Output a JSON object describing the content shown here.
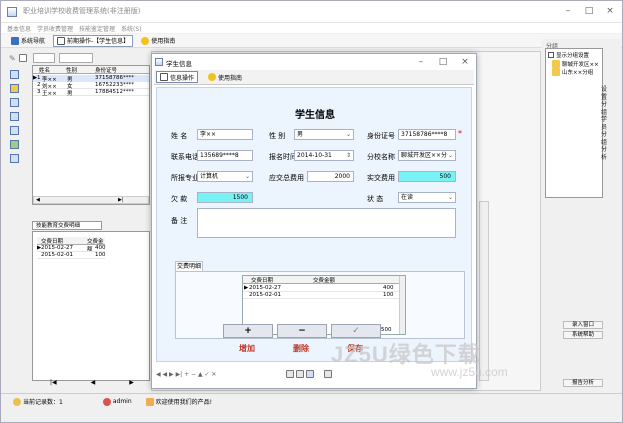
{
  "app": {
    "title": "职业培训学校收费管理系统(非注册版)",
    "window_controls": [
      "–",
      "□",
      "×"
    ]
  },
  "menu": [
    "基本信息",
    "学员收费管理",
    "技能鉴定管理",
    "系统(S)"
  ],
  "toolbar": {
    "tabs": [
      {
        "label": "系统导航",
        "active": false
      },
      {
        "label": "前期操作-【学生信息】",
        "active": true
      },
      {
        "label": "使用指南",
        "active": false
      }
    ]
  },
  "left_grid": {
    "headers": [
      "",
      "姓名",
      "性别",
      "身份证号"
    ],
    "rows": [
      {
        "marker": "▶",
        "num": "1",
        "name": "李××",
        "gender": "男",
        "id": "37158786****"
      },
      {
        "marker": "",
        "num": "2",
        "name": "刘××",
        "gender": "女",
        "id": "16752233****"
      },
      {
        "marker": "",
        "num": "3",
        "name": "王××",
        "gender": "男",
        "id": "17884512****"
      }
    ]
  },
  "left_pay": {
    "tab_label": "技能教育交费明细",
    "headers": [
      "交费日期",
      "交费金额"
    ],
    "rows": [
      {
        "marker": "▶",
        "date": "2015-02-27",
        "amount": "400"
      },
      {
        "marker": "",
        "date": "2015-02-01",
        "amount": "100"
      }
    ]
  },
  "statusbar": {
    "record_count": "当前记录数：1",
    "user": "admin",
    "welcome": "欢迎使用我们的产品!"
  },
  "right_panel": {
    "title": "分组",
    "show_tree_label": "显示分组设置",
    "tree": [
      "聊城开发区××",
      "山东××分组"
    ],
    "side_text": [
      "设",
      "置",
      "分",
      "组",
      "学",
      "员",
      "分",
      "组",
      "分",
      "析"
    ],
    "buttons": [
      "录入窗口",
      "系统帮助",
      "报告分析"
    ]
  },
  "dialog": {
    "title": "学生信息",
    "window_controls": [
      "–",
      "□",
      "×"
    ],
    "tabs": [
      {
        "label": "信息操作",
        "active": true
      },
      {
        "label": "使用指南",
        "active": false
      }
    ],
    "form_title": "学生信息",
    "labels": {
      "name": "姓    名",
      "gender": "性    别",
      "id_card": "身份证号",
      "phone": "联系电话",
      "enroll_time": "报名时间",
      "branch": "分校名称",
      "major": "所报专业",
      "fee_due": "应交总费用",
      "fee_paid": "实交费用",
      "owed": "欠    款",
      "status": "状    态",
      "remark": "备    注"
    },
    "values": {
      "name": "李××",
      "gender": "男",
      "id_card": "37158786****8",
      "phone": "135689****8",
      "enroll_time": "2014-10-31",
      "branch": "聊城开发区××分",
      "major": "计算机",
      "fee_due": "2000",
      "fee_paid": "500",
      "owed": "1500",
      "status": "在读",
      "remark": ""
    },
    "fee_tab": "交费明细",
    "fee_grid": {
      "headers": [
        "交费日期",
        "交费金额"
      ],
      "rows": [
        {
          "marker": "▶",
          "date": "2015-02-27",
          "amount": "400"
        },
        {
          "marker": "",
          "date": "2015-02-01",
          "amount": "100"
        }
      ],
      "footer_value": "500"
    },
    "actions": [
      {
        "symbol": "+",
        "label": "增加"
      },
      {
        "symbol": "−",
        "label": "删除"
      },
      {
        "symbol": "✓",
        "label": "保存"
      }
    ],
    "nav": "◀ ◀ ▶ ▶| + − ▲ ✓ ✕"
  },
  "watermark": {
    "text": "JZ5U绿色下载",
    "url": "www.jz5u.com"
  }
}
